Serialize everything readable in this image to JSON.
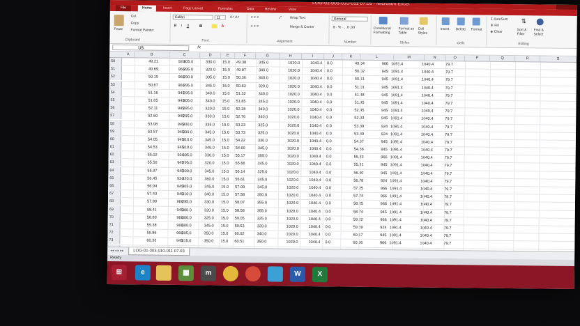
{
  "window": {
    "title": "LOG-01-003-010-011 07.03 - Microsoft Excel"
  },
  "ribbon": {
    "tabs": [
      "File",
      "Home",
      "Insert",
      "Page Layout",
      "Formulas",
      "Data",
      "Review",
      "View"
    ],
    "clipboard": {
      "paste": "Paste",
      "cut": "Cut",
      "copy": "Copy",
      "format_painter": "Format Painter",
      "group": "Clipboard"
    },
    "font": {
      "name": "Calibri",
      "size": "11",
      "group": "Font"
    },
    "alignment": {
      "wrap": "Wrap Text",
      "merge": "Merge & Center",
      "group": "Alignment"
    },
    "number": {
      "format": "General",
      "group": "Number"
    },
    "styles": {
      "conditional": "Conditional Formatting",
      "format_table": "Format as Table",
      "cell_styles": "Cell Styles",
      "group": "Styles"
    },
    "cells": {
      "insert": "Insert",
      "delete": "Delete",
      "format": "Format",
      "group": "Cells"
    },
    "editing": {
      "autosum": "AutoSum",
      "fill": "Fill",
      "clear": "Clear",
      "sort": "Sort & Filter",
      "find": "Find & Select",
      "group": "Editing"
    }
  },
  "formula_bar": {
    "name_box": "U5",
    "fx": "fx"
  },
  "columns": [
    "A",
    "B",
    "C",
    "D",
    "E",
    "F",
    "G",
    "H",
    "I",
    "J",
    "K",
    "L",
    "M",
    "N",
    "O",
    "P",
    "Q",
    "R",
    "S"
  ],
  "rows": [
    {
      "n": "50",
      "b": "49.21",
      "c": "924",
      "d": "305.0",
      "e": "330.0",
      "f": "15.0",
      "g": "49.38",
      "h": "345.0",
      "i": "1020.0",
      "j": "1040.4",
      "k": "0.0",
      "l": "49.54",
      "m": "966",
      "mn": "1091.4",
      "o": "1040.4",
      "p": "79.7"
    },
    {
      "n": "51",
      "b": "49.69",
      "c": "966",
      "d": "295.0",
      "e": "320.0",
      "f": "15.0",
      "g": "49.87",
      "h": "340.0",
      "i": "1020.0",
      "j": "1040.4",
      "k": "0.0",
      "l": "50.02",
      "m": "945",
      "mn": "1091.4",
      "o": "1040.4",
      "p": "79.7"
    },
    {
      "n": "52",
      "b": "50.19",
      "c": "966",
      "d": "290.0",
      "e": "335.0",
      "f": "15.0",
      "g": "50.36",
      "h": "340.0",
      "i": "1020.0",
      "j": "1040.4",
      "k": "0.0",
      "l": "50.51",
      "m": "945",
      "mn": "1091.4",
      "o": "1040.4",
      "p": "79.7"
    },
    {
      "n": "53",
      "b": "50.67",
      "c": "966",
      "d": "295.0",
      "e": "345.0",
      "f": "15.0",
      "g": "50.83",
      "h": "320.0",
      "i": "1020.0",
      "j": "1040.4",
      "k": "0.0",
      "l": "51.01",
      "m": "945",
      "mn": "1091.4",
      "o": "1040.4",
      "p": "79.7"
    },
    {
      "n": "54",
      "b": "51.16",
      "c": "945",
      "d": "295.0",
      "e": "340.0",
      "f": "15.0",
      "g": "51.32",
      "h": "340.0",
      "i": "1020.0",
      "j": "1040.4",
      "k": "0.0",
      "l": "51.48",
      "m": "945",
      "mn": "1091.4",
      "o": "1040.4",
      "p": "79.7"
    },
    {
      "n": "55",
      "b": "51.65",
      "c": "945",
      "d": "305.0",
      "e": "340.0",
      "f": "15.0",
      "g": "51.85",
      "h": "345.0",
      "i": "1020.0",
      "j": "1040.4",
      "k": "0.0",
      "l": "51.95",
      "m": "945",
      "mn": "1091.4",
      "o": "1040.4",
      "p": "79.7"
    },
    {
      "n": "56",
      "b": "52.11",
      "c": "945",
      "d": "295.0",
      "e": "320.0",
      "f": "15.0",
      "g": "52.28",
      "h": "340.0",
      "i": "1020.0",
      "j": "1040.4",
      "k": "0.0",
      "l": "52.45",
      "m": "945",
      "mn": "1091.4",
      "o": "1040.4",
      "p": "79.7"
    },
    {
      "n": "57",
      "b": "52.60",
      "c": "945",
      "d": "295.0",
      "e": "330.0",
      "f": "15.0",
      "g": "52.76",
      "h": "340.0",
      "i": "1020.0",
      "j": "1040.4",
      "k": "0.0",
      "l": "52.93",
      "m": "945",
      "mn": "1091.4",
      "o": "1040.4",
      "p": "79.7"
    },
    {
      "n": "58",
      "b": "53.08",
      "c": "945",
      "d": "300.0",
      "e": "335.0",
      "f": "15.0",
      "g": "53.23",
      "h": "325.0",
      "i": "1020.0",
      "j": "1040.4",
      "k": "0.0",
      "l": "53.39",
      "m": "924",
      "mn": "1091.4",
      "o": "1040.4",
      "p": "79.7"
    },
    {
      "n": "59",
      "b": "53.57",
      "c": "945",
      "d": "300.0",
      "e": "345.0",
      "f": "15.0",
      "g": "53.73",
      "h": "325.0",
      "i": "1020.0",
      "j": "1040.4",
      "k": "0.0",
      "l": "53.89",
      "m": "924",
      "mn": "1091.4",
      "o": "1040.4",
      "p": "79.7"
    },
    {
      "n": "60",
      "b": "54.05",
      "c": "945",
      "d": "310.0",
      "e": "345.0",
      "f": "15.0",
      "g": "54.22",
      "h": "330.0",
      "i": "1020.0",
      "j": "1040.4",
      "k": "0.0",
      "l": "54.37",
      "m": "945",
      "mn": "1091.4",
      "o": "1040.4",
      "p": "79.7"
    },
    {
      "n": "61",
      "b": "54.53",
      "c": "945",
      "d": "310.0",
      "e": "340.0",
      "f": "15.0",
      "g": "54.69",
      "h": "345.0",
      "i": "1020.0",
      "j": "1040.4",
      "k": "0.0",
      "l": "54.86",
      "m": "945",
      "mn": "1091.4",
      "o": "1040.4",
      "p": "79.7"
    },
    {
      "n": "62",
      "b": "55.02",
      "c": "924",
      "d": "305.0",
      "e": "330.0",
      "f": "15.0",
      "g": "55.17",
      "h": "355.0",
      "i": "1020.0",
      "j": "1040.4",
      "k": "0.0",
      "l": "55.33",
      "m": "966",
      "mn": "1091.4",
      "o": "1040.4",
      "p": "79.7"
    },
    {
      "n": "63",
      "b": "55.50",
      "c": "945",
      "d": "295.0",
      "e": "320.0",
      "f": "15.0",
      "g": "55.66",
      "h": "345.0",
      "i": "1020.0",
      "j": "1040.4",
      "k": "0.0",
      "l": "55.81",
      "m": "945",
      "mn": "1091.4",
      "o": "1040.4",
      "p": "79.7"
    },
    {
      "n": "64",
      "b": "55.97",
      "c": "945",
      "d": "300.0",
      "e": "345.0",
      "f": "15.0",
      "g": "56.14",
      "h": "325.0",
      "i": "1020.0",
      "j": "1040.4",
      "k": "0.0",
      "l": "56.30",
      "m": "945",
      "mn": "1091.4",
      "o": "1040.4",
      "p": "79.7"
    },
    {
      "n": "65",
      "b": "56.45",
      "c": "924",
      "d": "320.0",
      "e": "360.0",
      "f": "15.0",
      "g": "56.61",
      "h": "345.0",
      "i": "1020.0",
      "j": "1040.4",
      "k": "0.0",
      "l": "56.78",
      "m": "924",
      "mn": "1091.4",
      "o": "1040.4",
      "p": "79.7"
    },
    {
      "n": "66",
      "b": "56.94",
      "c": "945",
      "d": "305.0",
      "e": "345.0",
      "f": "15.0",
      "g": "57.09",
      "h": "345.0",
      "i": "1020.0",
      "j": "1040.4",
      "k": "0.0",
      "l": "57.25",
      "m": "966",
      "mn": "1091.4",
      "o": "1040.4",
      "p": "79.7"
    },
    {
      "n": "67",
      "b": "57.43",
      "c": "945",
      "d": "310.0",
      "e": "340.0",
      "f": "15.0",
      "g": "57.58",
      "h": "350.0",
      "i": "1020.0",
      "j": "1040.4",
      "k": "0.0",
      "l": "57.74",
      "m": "966",
      "mn": "1091.4",
      "o": "1040.4",
      "p": "79.7"
    },
    {
      "n": "68",
      "b": "57.89",
      "c": "966",
      "d": "295.0",
      "e": "330.0",
      "f": "15.0",
      "g": "58.07",
      "h": "355.0",
      "i": "1020.0",
      "j": "1040.4",
      "k": "0.0",
      "l": "58.25",
      "m": "966",
      "mn": "1091.4",
      "o": "1040.4",
      "p": "79.7"
    },
    {
      "n": "69",
      "b": "58.41",
      "c": "945",
      "d": "300.0",
      "e": "320.0",
      "f": "15.0",
      "g": "58.58",
      "h": "355.0",
      "i": "1020.0",
      "j": "1040.4",
      "k": "0.0",
      "l": "58.74",
      "m": "945",
      "mn": "1091.4",
      "o": "1040.4",
      "p": "79.7"
    },
    {
      "n": "70",
      "b": "58.89",
      "c": "966",
      "d": "300.0",
      "e": "325.0",
      "f": "15.0",
      "g": "59.05",
      "h": "325.0",
      "i": "1020.0",
      "j": "1040.4",
      "k": "0.0",
      "l": "59.22",
      "m": "966",
      "mn": "1091.4",
      "o": "1040.4",
      "p": "79.7"
    },
    {
      "n": "71",
      "b": "59.38",
      "c": "966",
      "d": "300.0",
      "e": "345.0",
      "f": "15.0",
      "g": "59.53",
      "h": "320.0",
      "i": "1020.0",
      "j": "1040.4",
      "k": "0.0",
      "l": "59.69",
      "m": "924",
      "mn": "1091.4",
      "o": "1040.4",
      "p": "79.7"
    },
    {
      "n": "72",
      "b": "59.86",
      "c": "966",
      "d": "305.0",
      "e": "350.0",
      "f": "15.0",
      "g": "60.02",
      "h": "340.0",
      "i": "1020.0",
      "j": "1040.4",
      "k": "0.0",
      "l": "60.17",
      "m": "945",
      "mn": "1091.4",
      "o": "1040.4",
      "p": "79.7"
    },
    {
      "n": "73",
      "b": "60.33",
      "c": "945",
      "d": "315.0",
      "e": "350.0",
      "f": "15.0",
      "g": "60.51",
      "h": "350.0",
      "i": "1020.0",
      "j": "1040.4",
      "k": "0.0",
      "l": "60.66",
      "m": "966",
      "mn": "1091.4",
      "o": "1040.4",
      "p": "79.7"
    },
    {
      "n": "74",
      "b": "60.86",
      "c": "945",
      "d": "305.0",
      "e": "345.0",
      "f": "15.0",
      "g": "61.04",
      "h": "320.0",
      "i": "1020.0",
      "j": "1040.4",
      "k": "0.0",
      "l": "61.19",
      "m": "924",
      "mn": "1091.4",
      "o": "1040.4",
      "p": "79.7"
    }
  ],
  "sheet_tab": "LOG-01-003-010-011 07.03",
  "status": "Ready",
  "taskbar": [
    "start-button",
    "ie-icon",
    "explorer-icon",
    "calculator-icon",
    "media-app-icon",
    "chrome-icon",
    "chrome-icon",
    "files-icon",
    "word-icon",
    "excel-icon"
  ],
  "colors": {
    "accent": "#b91c1c",
    "taskbar": "#8a1626"
  }
}
